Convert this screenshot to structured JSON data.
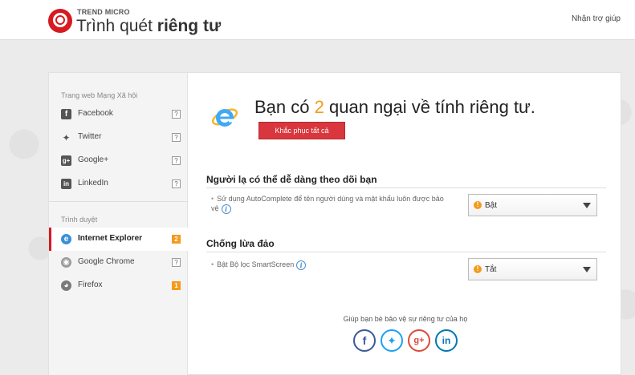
{
  "header": {
    "brand_small": "TREND MICRO",
    "title_regular": "Trình quét",
    "title_bold": "riêng tư",
    "help_link": "Nhận trợ giúp"
  },
  "sidebar": {
    "social_heading": "Trang web Mạng Xã hội",
    "social_items": [
      {
        "label": "Facebook",
        "badge": "?",
        "icon": "facebook-icon"
      },
      {
        "label": "Twitter",
        "badge": "?",
        "icon": "twitter-icon"
      },
      {
        "label": "Google+",
        "badge": "?",
        "icon": "google-plus-icon"
      },
      {
        "label": "LinkedIn",
        "badge": "?",
        "icon": "linkedin-icon"
      }
    ],
    "browser_heading": "Trình duyệt",
    "browser_items": [
      {
        "label": "Internet Explorer",
        "badge": "2",
        "icon": "internet-explorer-icon",
        "active": true
      },
      {
        "label": "Google Chrome",
        "badge": "?",
        "icon": "chrome-icon"
      },
      {
        "label": "Firefox",
        "badge": "1",
        "icon": "firefox-icon"
      }
    ]
  },
  "main": {
    "headline_prefix": "Bạn có",
    "concern_count": "2",
    "headline_suffix": "quan ngại về tính riêng tư.",
    "fix_all_label": "Khắc phục tất cả",
    "sections": [
      {
        "title": "Người lạ có thể dễ dàng theo dõi bạn",
        "setting": "Sử dụng AutoComplete để tên người dùng và mật khẩu luôn được bảo vệ",
        "value": "Bật"
      },
      {
        "title": "Chống lừa đảo",
        "setting": "Bật Bộ lọc SmartScreen",
        "value": "Tắt"
      }
    ],
    "share_text": "Giúp bạn bè bảo vệ sự riêng tư của họ",
    "share_icons": [
      "facebook-icon",
      "twitter-icon",
      "google-plus-icon",
      "linkedin-icon"
    ]
  },
  "colors": {
    "brand_red": "#d71920",
    "fix_button": "#d9373d",
    "accent_orange": "#f59a1b"
  }
}
